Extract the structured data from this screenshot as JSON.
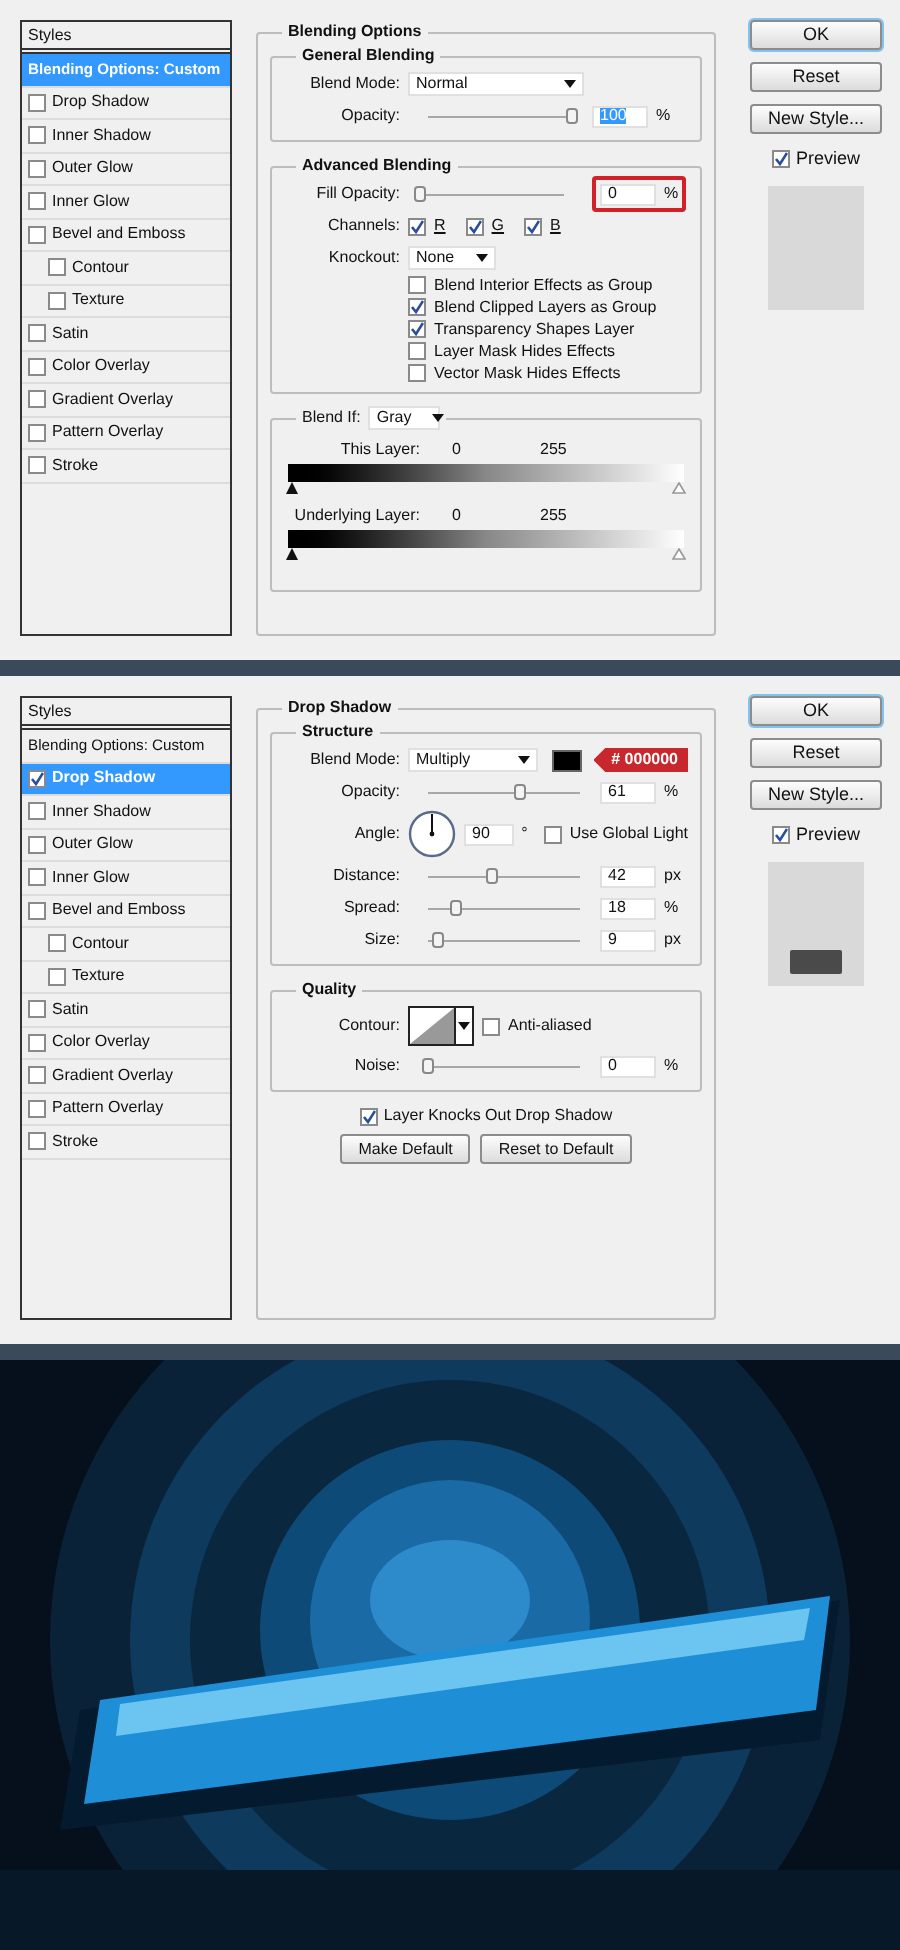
{
  "dialogs": [
    {
      "styles_header": "Styles",
      "styles": [
        {
          "label": "Blending Options: Custom",
          "kind": "header",
          "selected": true
        },
        {
          "label": "Drop Shadow",
          "kind": "check",
          "checked": false,
          "selected": false
        },
        {
          "label": "Inner Shadow",
          "kind": "check",
          "checked": false,
          "selected": false
        },
        {
          "label": "Outer Glow",
          "kind": "check",
          "checked": false,
          "selected": false
        },
        {
          "label": "Inner Glow",
          "kind": "check",
          "checked": false,
          "selected": false
        },
        {
          "label": "Bevel and Emboss",
          "kind": "check",
          "checked": false,
          "selected": false,
          "children": [
            {
              "label": "Contour",
              "kind": "check",
              "checked": false,
              "selected": false
            },
            {
              "label": "Texture",
              "kind": "check",
              "checked": false,
              "selected": false
            }
          ]
        },
        {
          "label": "Satin",
          "kind": "check",
          "checked": false,
          "selected": false
        },
        {
          "label": "Color Overlay",
          "kind": "check",
          "checked": false,
          "selected": false
        },
        {
          "label": "Gradient Overlay",
          "kind": "check",
          "checked": false,
          "selected": false
        },
        {
          "label": "Pattern Overlay",
          "kind": "check",
          "checked": false,
          "selected": false
        },
        {
          "label": "Stroke",
          "kind": "check",
          "checked": false,
          "selected": false
        }
      ],
      "title": "Blending Options",
      "sections": [
        {
          "kind": "group",
          "title": "General Blending",
          "rows": [
            {
              "kind": "select",
              "label": "Blend Mode:",
              "value": "Normal"
            },
            {
              "kind": "slider",
              "label": "Opacity:",
              "level": 1,
              "value": "100",
              "value_selected": true,
              "unit": "%",
              "highlighted": false
            }
          ]
        },
        {
          "kind": "group",
          "title": "Advanced Blending",
          "rows": [
            {
              "kind": "slider",
              "label": "Fill Opacity:",
              "level": 0,
              "value": "0",
              "value_selected": false,
              "unit": "%",
              "highlighted": true
            },
            {
              "kind": "channels",
              "label": "Channels:",
              "options": [
                {
                  "label": "R",
                  "checked": true
                },
                {
                  "label": "G",
                  "checked": true
                },
                {
                  "label": "B",
                  "checked": true
                }
              ]
            },
            {
              "kind": "select",
              "label": "Knockout:",
              "value": "None"
            },
            {
              "kind": "checkbox",
              "label": "Blend Interior Effects as Group",
              "checked": false
            },
            {
              "kind": "checkbox",
              "label": "Blend Clipped Layers as Group",
              "checked": true
            },
            {
              "kind": "checkbox",
              "label": "Transparency Shapes Layer",
              "checked": true
            },
            {
              "kind": "checkbox",
              "label": "Layer Mask Hides Effects",
              "checked": false
            },
            {
              "kind": "checkbox",
              "label": "Vector Mask Hides Effects",
              "checked": false
            }
          ]
        },
        {
          "kind": "blend_if",
          "label": "Blend If:",
          "value": "Gray",
          "layers": [
            {
              "label": "This Layer:",
              "low": "0",
              "high": "255"
            },
            {
              "label": "Underlying Layer:",
              "low": "0",
              "high": "255"
            }
          ]
        }
      ],
      "buttons": [
        {
          "label": "OK",
          "kind": "default"
        },
        {
          "label": "Reset",
          "kind": "normal"
        },
        {
          "label": "New Style...",
          "kind": "normal"
        }
      ],
      "preview": {
        "label": "Preview",
        "checked": true,
        "shows_shadow": false
      }
    },
    {
      "styles_header": "Styles",
      "styles": [
        {
          "label": "Blending Options: Custom",
          "kind": "header",
          "selected": false
        },
        {
          "label": "Drop Shadow",
          "kind": "check",
          "checked": true,
          "selected": true
        },
        {
          "label": "Inner Shadow",
          "kind": "check",
          "checked": false,
          "selected": false
        },
        {
          "label": "Outer Glow",
          "kind": "check",
          "checked": false,
          "selected": false
        },
        {
          "label": "Inner Glow",
          "kind": "check",
          "checked": false,
          "selected": false
        },
        {
          "label": "Bevel and Emboss",
          "kind": "check",
          "checked": false,
          "selected": false,
          "children": [
            {
              "label": "Contour",
              "kind": "check",
              "checked": false,
              "selected": false
            },
            {
              "label": "Texture",
              "kind": "check",
              "checked": false,
              "selected": false
            }
          ]
        },
        {
          "label": "Satin",
          "kind": "check",
          "checked": false,
          "selected": false
        },
        {
          "label": "Color Overlay",
          "kind": "check",
          "checked": false,
          "selected": false
        },
        {
          "label": "Gradient Overlay",
          "kind": "check",
          "checked": false,
          "selected": false
        },
        {
          "label": "Pattern Overlay",
          "kind": "check",
          "checked": false,
          "selected": false
        },
        {
          "label": "Stroke",
          "kind": "check",
          "checked": false,
          "selected": false
        }
      ],
      "title": "Drop Shadow",
      "sections": [
        {
          "kind": "group",
          "title": "Structure",
          "rows": [
            {
              "kind": "select",
              "label": "Blend Mode:",
              "value": "Multiply",
              "color": "#000000",
              "callout": "# 000000"
            },
            {
              "kind": "slider",
              "label": "Opacity:",
              "level": 0.61,
              "value": "61",
              "value_selected": false,
              "unit": "%",
              "highlighted": false
            },
            {
              "kind": "angle",
              "label": "Angle:",
              "value": "90",
              "unit": "°",
              "option": {
                "label": "Use Global Light",
                "checked": false
              }
            },
            {
              "kind": "slider",
              "label": "Distance:",
              "level": 0.42,
              "value": "42",
              "value_selected": false,
              "unit": "px",
              "highlighted": false
            },
            {
              "kind": "slider",
              "label": "Spread:",
              "level": 0.18,
              "value": "18",
              "value_selected": false,
              "unit": "%",
              "highlighted": false
            },
            {
              "kind": "slider",
              "label": "Size:",
              "level": 0.07,
              "value": "9",
              "value_selected": false,
              "unit": "px",
              "highlighted": false
            }
          ]
        },
        {
          "kind": "group",
          "title": "Quality",
          "rows": [
            {
              "kind": "contour",
              "label": "Contour:",
              "option": {
                "label": "Anti-aliased",
                "checked": false
              }
            },
            {
              "kind": "slider",
              "label": "Noise:",
              "level": 0,
              "value": "0",
              "value_selected": false,
              "unit": "%",
              "highlighted": false
            }
          ]
        }
      ],
      "footer": {
        "checkbox": {
          "label": "Layer Knocks Out Drop Shadow",
          "checked": true
        },
        "buttons": [
          "Make Default",
          "Reset to Default"
        ]
      },
      "buttons": [
        {
          "label": "OK",
          "kind": "default"
        },
        {
          "label": "Reset",
          "kind": "normal"
        },
        {
          "label": "New Style...",
          "kind": "normal"
        }
      ],
      "preview": {
        "label": "Preview",
        "checked": true,
        "shows_shadow": true
      }
    }
  ]
}
